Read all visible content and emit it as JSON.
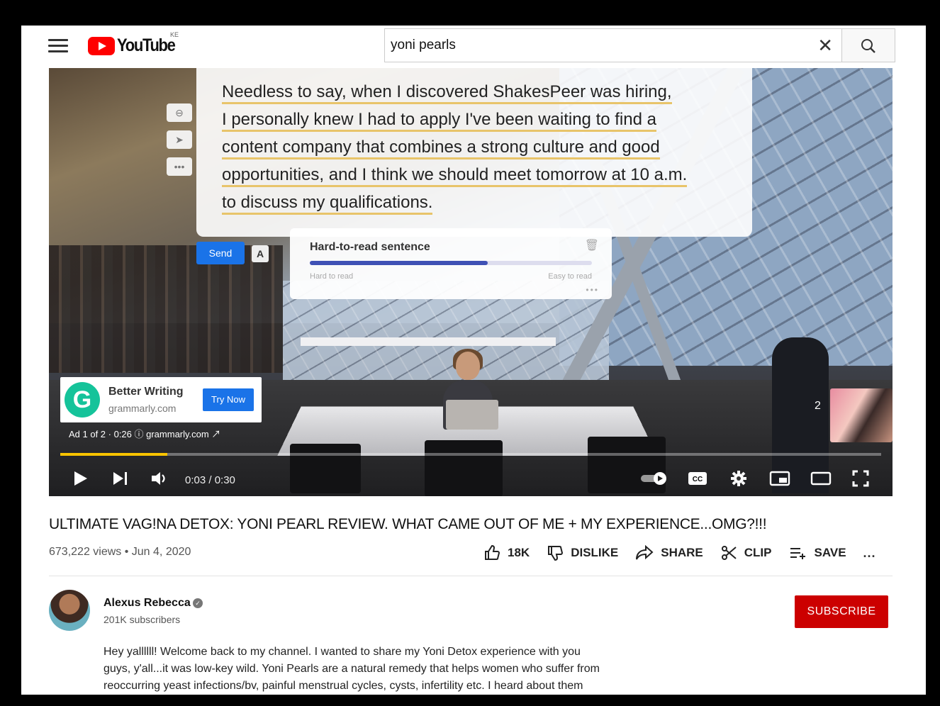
{
  "header": {
    "logo_text": "YouTube",
    "country_code": "KE",
    "search_value": "yoni pearls",
    "search_placeholder": "Search"
  },
  "overlay": {
    "text_lines": [
      "Needless to say, when I discovered ShakesPeer was hiring,",
      "I personally knew I had to apply I've been waiting to find a",
      "content company that combines a strong culture and good",
      "opportunities, and I think we should meet tomorrow at 10 a.m.",
      "to discuss my qualifications."
    ],
    "send_label": "Send",
    "format_label": "A",
    "suggestion_title": "Hard-to-read sentence",
    "meter_left": "Hard to read",
    "meter_right": "Easy to read",
    "meter_fraction": 0.63
  },
  "ad": {
    "logo_letter": "G",
    "title": "Better Writing",
    "domain": "grammarly.com",
    "cta": "Try Now",
    "info": "Ad 1 of 2 · 0:26 ⓘ grammarly.com ↗"
  },
  "player": {
    "time": "0:03 / 0:30",
    "progress_fraction": 0.13,
    "next_count": "2"
  },
  "video": {
    "title": "ULTIMATE VAG!NA DETOX: YONI PEARL REVIEW. WHAT CAME OUT OF ME + MY EXPERIENCE...OMG?!!!",
    "views": "673,222 views • Jun 4, 2020",
    "like_count": "18K",
    "dislike_label": "DISLIKE",
    "share_label": "SHARE",
    "clip_label": "CLIP",
    "save_label": "SAVE",
    "more_label": "..."
  },
  "channel": {
    "name": "Alexus Rebecca",
    "subscribers": "201K subscribers",
    "subscribe_label": "SUBSCRIBE",
    "description_lines": [
      "Hey yallllll! Welcome back to my channel. I wanted to share my Yoni Detox experience with you",
      "guys, y'all...it was low-key wild. Yoni Pearls are a natural remedy that helps women who suffer from",
      "reoccurring yeast infections/bv, painful menstrual cycles, cysts, infertility etc. I heard about them"
    ]
  },
  "colors": {
    "brand_red": "#ff0000",
    "subscribe_red": "#cc0000",
    "ad_progress": "#f9c400",
    "grammarly_green": "#15c39a",
    "grammarly_blue": "#1a73e8"
  }
}
